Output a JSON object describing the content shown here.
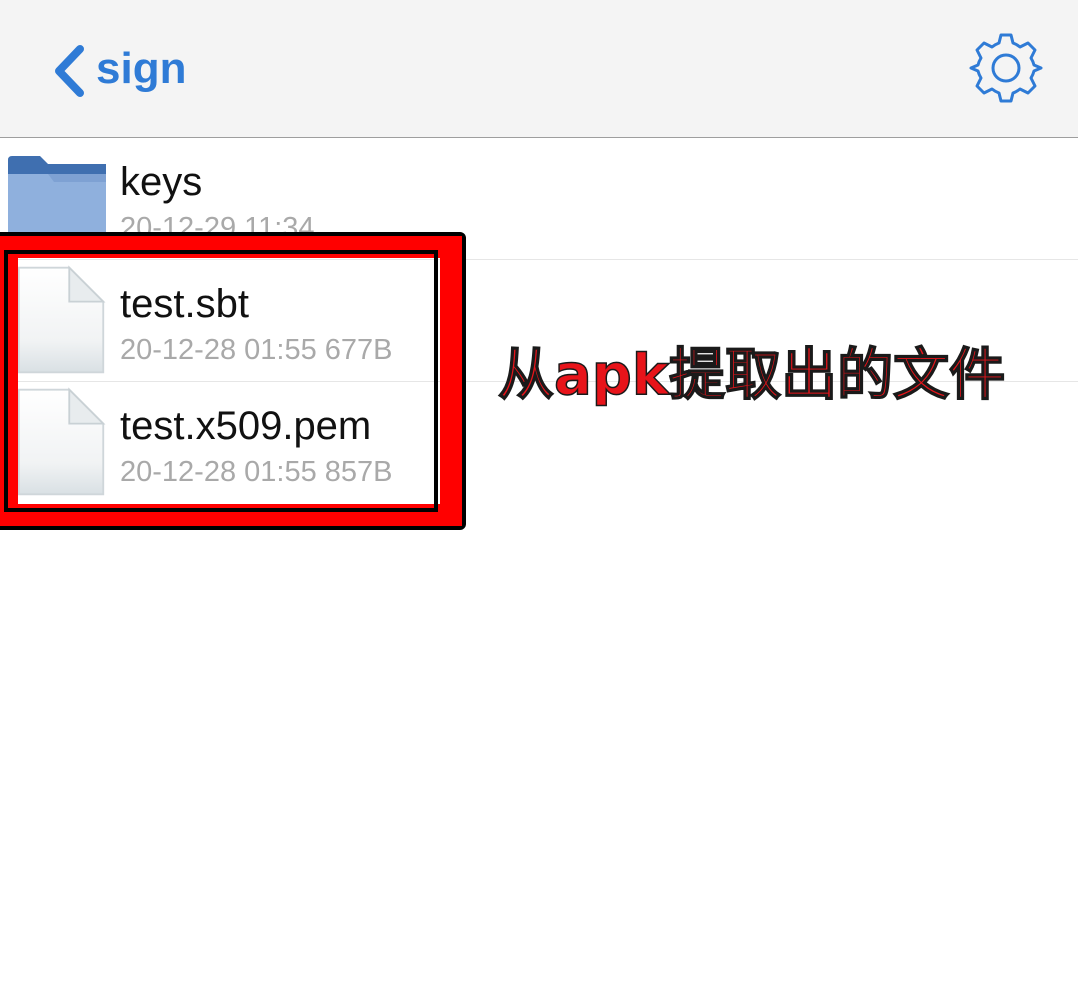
{
  "header": {
    "back_label": "sign",
    "back_icon": "chevron-left-icon",
    "settings_icon": "gear-icon",
    "accent_color": "#2f7bd6"
  },
  "files": [
    {
      "name": "keys",
      "meta": "20-12-29 11:34",
      "icon": "folder-icon"
    },
    {
      "name": "test.sbt",
      "meta": "20-12-28 01:55 677B",
      "icon": "file-icon"
    },
    {
      "name": "test.x509.pem",
      "meta": "20-12-28 01:55 857B",
      "icon": "file-icon"
    }
  ],
  "annotation": {
    "text": "从apk提取出的文件",
    "color": "#ff0000"
  }
}
